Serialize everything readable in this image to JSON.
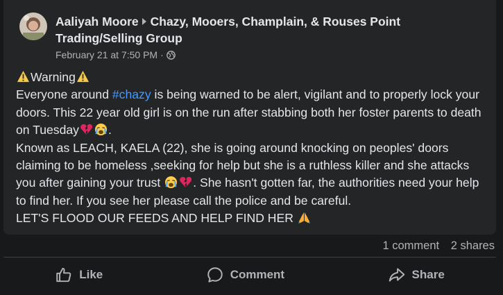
{
  "post": {
    "author": "Aaliyah Moore",
    "group_line1": "Chazy, Mooers, Champlain, & Rouses Point",
    "group_line2": "Trading/Selling Group",
    "timestamp": "February 21 at 7:50 PM",
    "separator": "·",
    "privacy_icon": "globe-icon",
    "warning_label": "Warning",
    "p1_a": "Everyone around ",
    "hashtag": "#chazy",
    "p1_b": " is being warned to be alert, vigilant and to properly lock your doors. This 22 year old girl is on the run after stabbing both her foster parents to death on Tuesday",
    "p1_end": ".",
    "p2_a": "Known as LEACH, KAELA (22), she is going around knocking on peoples' doors claiming to be homeless ,seeking for help but she is a ruthless killer and she attacks you after gaining your trust ",
    "p2_b": ". She hasn't gotten far, the authorities need your help to find her. If you see her please call the police and be careful.",
    "p3": "LET'S FLOOD OUR FEEDS AND HELP FIND HER "
  },
  "stats": {
    "comments": "1 comment",
    "shares": "2 shares"
  },
  "actions": {
    "like": "Like",
    "comment": "Comment",
    "share": "Share"
  },
  "colors": {
    "background": "#18191a",
    "card": "#242526",
    "primary_text": "#e4e6eb",
    "secondary_text": "#b0b3b8",
    "link": "#4599ff"
  }
}
